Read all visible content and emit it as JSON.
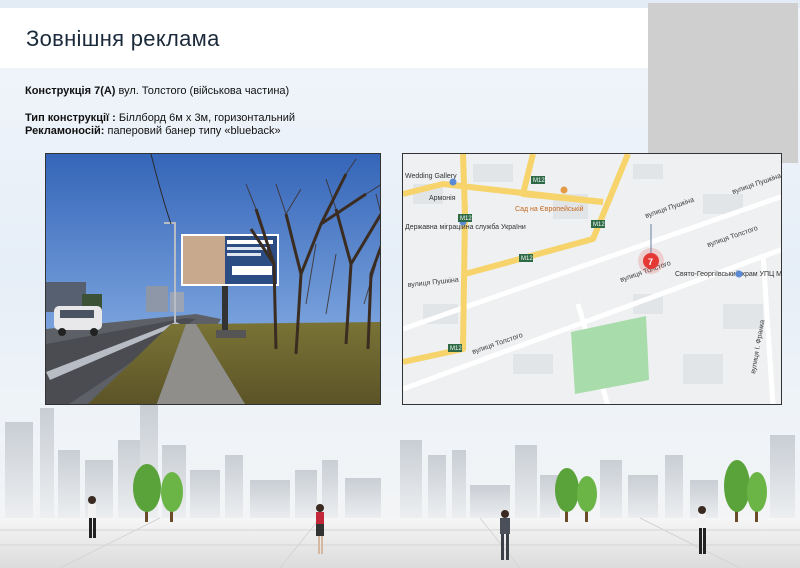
{
  "header": {
    "title": "Зовнішня реклама"
  },
  "construction": {
    "label": "Конструкція 7(А)",
    "address": "вул. Толстого (військова частина)"
  },
  "type": {
    "label": "Тип конструкції :",
    "value": "Біллборд 6м х 3м, горизонтальний"
  },
  "carrier": {
    "label": "Рекламоносій:",
    "value": "паперовий банер типу «blueback»"
  },
  "map": {
    "streets": [
      "вулиця Пушкіна",
      "вулиця Толстого",
      "вулиця Толстого",
      "вулиця Пушкіна",
      "вулиця Пушкіна",
      "вулиця Толстого",
      "вулиця Пушкіна",
      "вулиця Пушкіна",
      "вулиця І. Франка"
    ],
    "places": [
      "Wedding Gallery",
      "Армонія",
      "Сад на Європейській",
      "Державна міграційна служба України",
      "Свято-Георгіївський храм УПЦ МП (РПЦ)"
    ],
    "road_labels": [
      "M12",
      "M12",
      "M12",
      "M12",
      "M12"
    ],
    "marker_number": "7",
    "colors": {
      "road_major": "#f6d46b",
      "road_minor": "#ffffff",
      "park": "#a8dcaa",
      "marker": "#e53935"
    }
  },
  "photo": {
    "icon": "billboard-photo"
  }
}
